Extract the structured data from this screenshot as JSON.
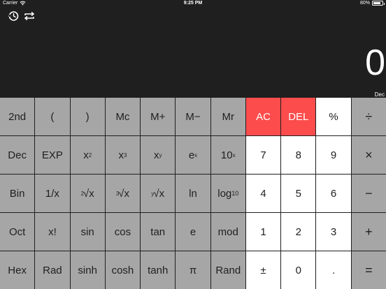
{
  "status": {
    "carrier": "Carrier",
    "time": "9:25 PM",
    "battery": "80%",
    "battery_level": 0.8
  },
  "display": {
    "value": "0",
    "mode": "Dec",
    "icons": [
      "history-icon",
      "swap-icon"
    ]
  },
  "keys": {
    "row1": [
      "2nd",
      "(",
      ")",
      "Mc",
      "M+",
      "M−",
      "Mr",
      "AC",
      "DEL",
      "%",
      "÷"
    ],
    "row2": [
      "Dec",
      "EXP",
      "x",
      "x",
      "x",
      "e",
      "10",
      "7",
      "8",
      "9",
      "×"
    ],
    "row2_sup": [
      "2",
      "3",
      "y",
      "x",
      "x"
    ],
    "row3": [
      "Bin",
      "1/x",
      "√x",
      "√x",
      "√x",
      "ln",
      "log",
      "4",
      "5",
      "6",
      "−"
    ],
    "row3_pre": [
      "2",
      "3",
      "y"
    ],
    "row3_sub": "10",
    "row4": [
      "Oct",
      "x!",
      "sin",
      "cos",
      "tan",
      "e",
      "mod",
      "1",
      "2",
      "3",
      "+"
    ],
    "row5": [
      "Hex",
      "Rad",
      "sinh",
      "cosh",
      "tanh",
      "π",
      "Rand",
      "±",
      "0",
      ".",
      "="
    ]
  },
  "colors": {
    "background": "#1f1f1f",
    "function_key": "#a6a6a6",
    "number_key": "#ffffff",
    "clear_key": "#fc4c4c"
  }
}
